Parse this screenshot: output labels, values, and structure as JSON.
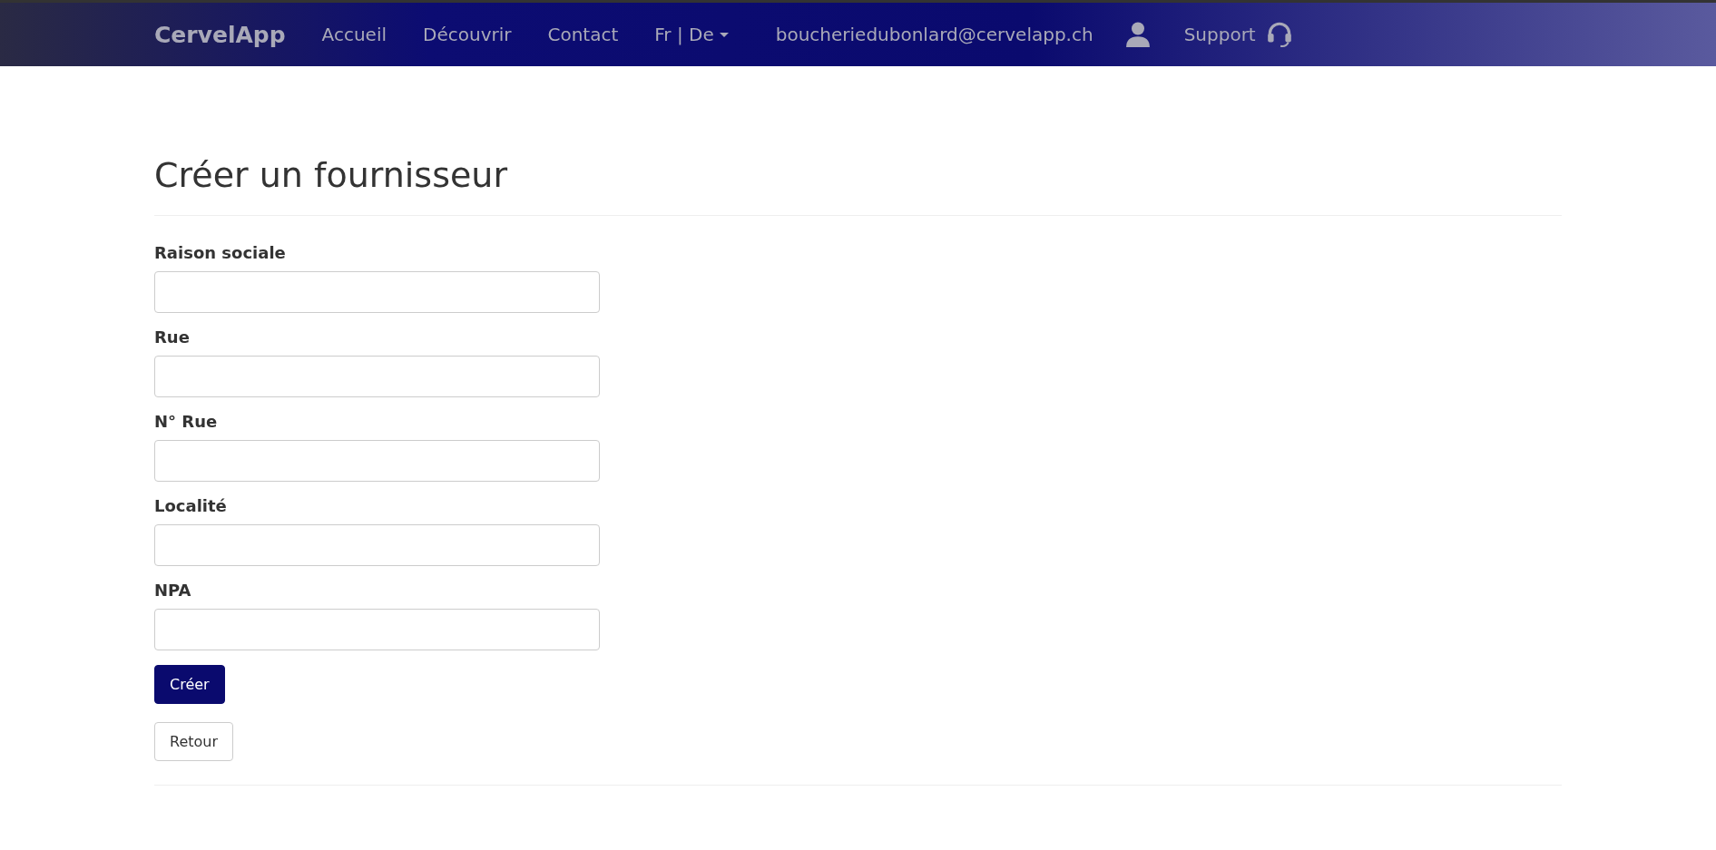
{
  "navbar": {
    "brand": "CervelApp",
    "links": [
      "Accueil",
      "Découvrir",
      "Contact"
    ],
    "language": "Fr | De",
    "email": "boucheriedubonlard@cervelapp.ch",
    "support": "Support"
  },
  "page": {
    "title": "Créer un fournisseur"
  },
  "form": {
    "fields": [
      {
        "label": "Raison sociale"
      },
      {
        "label": "Rue"
      },
      {
        "label": "N° Rue"
      },
      {
        "label": "Localité"
      },
      {
        "label": "NPA"
      }
    ],
    "submit": "Créer",
    "back": "Retour"
  }
}
